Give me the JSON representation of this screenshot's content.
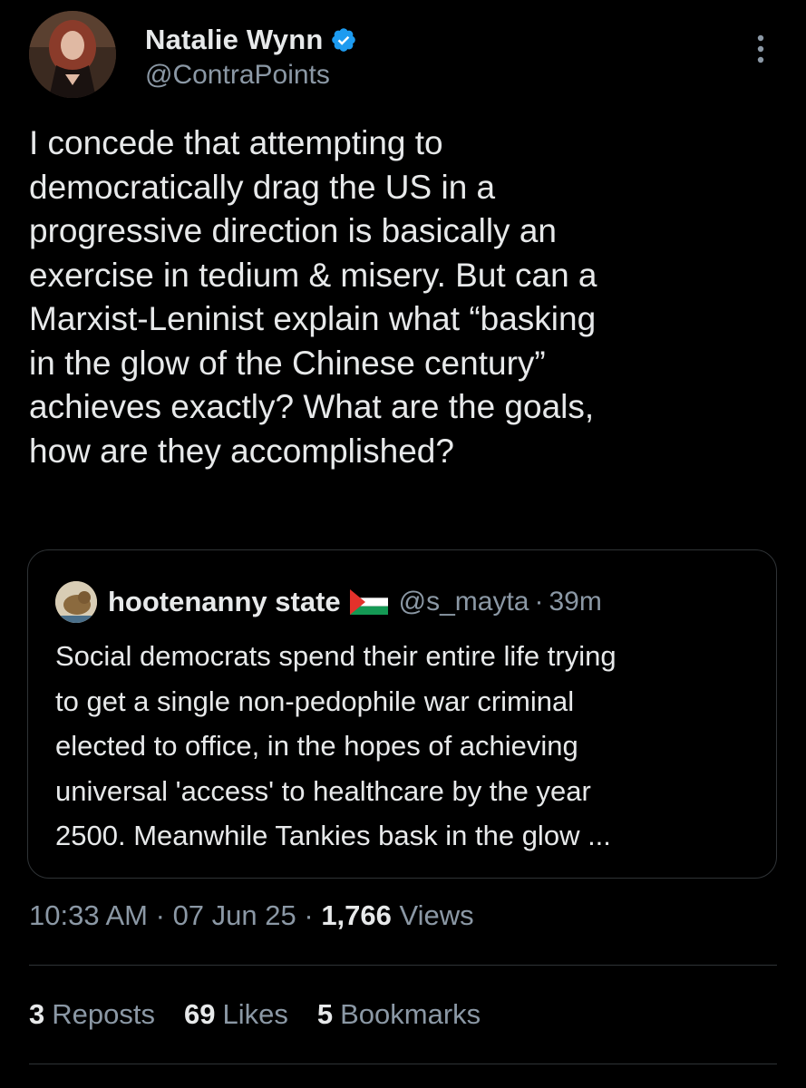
{
  "tweet": {
    "author": {
      "display_name": "Natalie Wynn",
      "handle": "@ContraPoints",
      "verified": true,
      "avatar_icon": "avatar"
    },
    "more_icon": "more-vertical-icon",
    "text": "I concede that attempting to\ndemocratically drag the US in a\nprogressive direction is basically an\nexercise in tedium & misery. But can a\nMarxist-Leninist explain what “basking\nin the glow of the Chinese century”\nachieves exactly? What are the goals,\nhow are they accomplished?",
    "quoted": {
      "display_name": "hootenanny state",
      "flag_icon": "palestine-flag-icon",
      "handle": "@s_mayta",
      "separator": "·",
      "time": "39m",
      "text": "Social democrats spend their entire life trying\nto get a single non-pedophile war criminal\nelected to office, in the hopes of achieving\nuniversal 'access' to healthcare by the year\n2500. Meanwhile Tankies bask in the glow ..."
    },
    "meta": {
      "time": "10:33 AM",
      "date": "07 Jun 25",
      "separator": "·",
      "views_count": "1,766",
      "views_label": "Views"
    },
    "stats": {
      "reposts_count": "3",
      "reposts_label": "Reposts",
      "likes_count": "69",
      "likes_label": "Likes",
      "bookmarks_count": "5",
      "bookmarks_label": "Bookmarks"
    }
  },
  "colors": {
    "background": "#000000",
    "text_primary": "#e7e9ea",
    "text_secondary": "#8b98a5",
    "border": "#2f3336",
    "verified_blue": "#1d9bf0"
  }
}
